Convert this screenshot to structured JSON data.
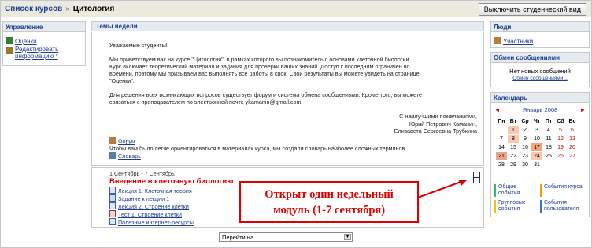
{
  "breadcrumb": {
    "course_list": "Список курсов",
    "separator": "»",
    "current": "Цитология"
  },
  "toolbar": {
    "student_view_button": "Выключить студенческий вид"
  },
  "blocks": {
    "admin": {
      "title": "Управление",
      "items": [
        "Оценки",
        "Редактировать информацию *"
      ]
    },
    "people": {
      "title": "Люди",
      "items": [
        "Участники"
      ]
    },
    "messages": {
      "title": "Обмен сообщениями",
      "empty": "Нет новых сообщений",
      "link": "Обмен сообщениями..."
    },
    "calendar": {
      "title": "Календарь",
      "prev": "◄",
      "month": "Январь 2008",
      "next": "►",
      "weekdays": [
        "Пн",
        "Вт",
        "Ср",
        "Чт",
        "Пт",
        "Сб",
        "Вс"
      ],
      "weeks": [
        [
          "",
          "1",
          "2",
          "3",
          "4",
          "5",
          "6"
        ],
        [
          "7",
          "8",
          "9",
          "10",
          "11",
          "12",
          "13"
        ],
        [
          "14",
          "15",
          "16",
          "17",
          "18",
          "19",
          "20"
        ],
        [
          "21",
          "22",
          "23",
          "24",
          "25",
          "26",
          "27"
        ],
        [
          "28",
          "29",
          "30",
          "31",
          "",
          "",
          ""
        ]
      ],
      "legend": [
        "Общие события",
        "События курса",
        "Групповые события",
        "События пользователя"
      ],
      "colors": {
        "today": "#f4a57b",
        "event": "#e8a48a",
        "general": "#3cb371",
        "course": "#ff9900",
        "group": "#f2c200",
        "user": "#4169e1"
      }
    }
  },
  "center": {
    "title": "Темы недели",
    "intro": [
      "Уважаемые студенты!",
      "Мы приветствуем вас на курсе \"Цитология\", в рамках которого вы познакомитесь с основами клеточной биологии.",
      "Курс включает теоретический материал и задания для проверки ваших знаний. Доступ к последним ограничен во",
      "времени, поэтому мы призываем вас выполнять все работы в срок. Свои результаты вы можете увидеть на странице",
      "\"Оценки\".",
      "Для решения всех возникающих вопросов существует форум и система обмена сообщениями. Кроме того, вы можете",
      "связаться с преподавателем по электронной почте ykamanin@gmail.com."
    ],
    "signature": [
      "С наилучшими пожеланиями,",
      "Юрий Петрович Каманин,",
      "Елизавета Сергеевна Трубкина"
    ],
    "forum": "Форум",
    "glossary_note": "Чтобы вам было легче ориентироваться в материалах курса, мы создали словарь наиболее сложных терминов",
    "glossary": "Словарь",
    "week": {
      "dates": "1 Сентябрь - 7 Сентябрь",
      "title": "Введение в клеточную биологию",
      "items": [
        "Лекция 1. Клеточная теория",
        "Задание к лекции 1",
        "Лекция 2. Строение клетки",
        "Тест 1. Строение клетки",
        "Полезные интернет-ресурсы"
      ]
    }
  },
  "annotation": {
    "line1": "Открыт один недельный",
    "line2": "модуль (1-7 сентября)",
    "color": "#dd0000"
  },
  "jump": {
    "label": "Перейти на..."
  }
}
